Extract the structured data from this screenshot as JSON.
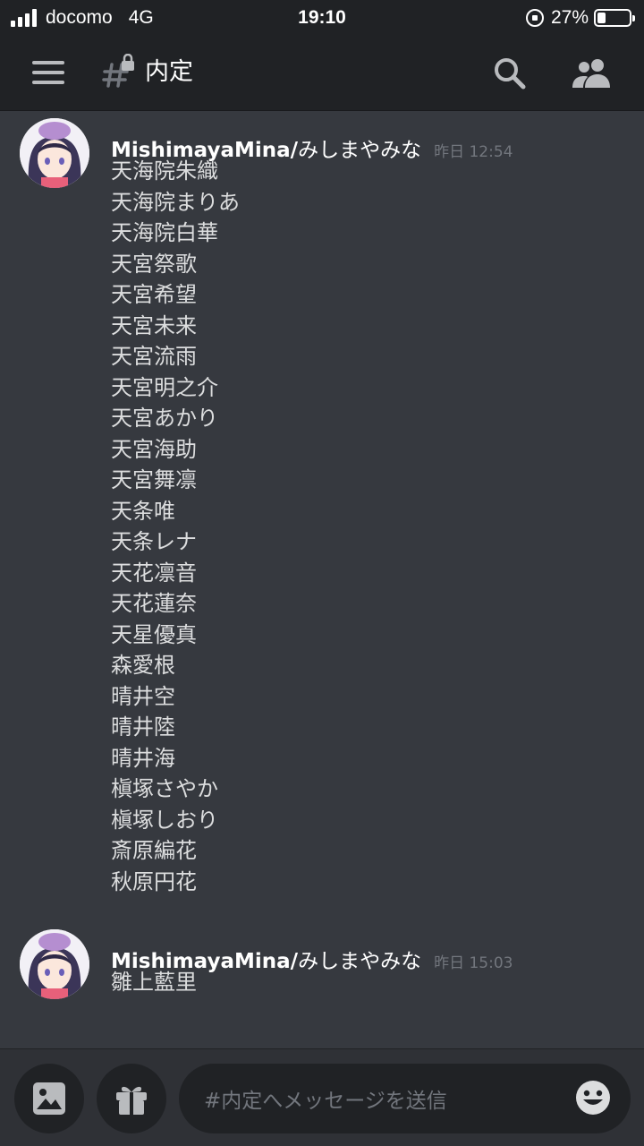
{
  "statusbar": {
    "carrier": "docomo",
    "network": "4G",
    "time": "19:10",
    "battery_percent": "27%",
    "battery_level": 0.27
  },
  "header": {
    "channel_name": "内定",
    "menu_icon": "hamburger-icon",
    "channel_icon": "locked-hash-icon",
    "search_icon": "search-icon",
    "members_icon": "members-icon"
  },
  "messages": [
    {
      "author": "MishimayaMina/",
      "author_jp": "みしまやみな",
      "timestamp": "昨日 12:54",
      "lines": [
        "天海院朱織",
        "天海院まりあ",
        "天海院白華",
        "天宮祭歌",
        "天宮希望",
        "天宮未来",
        "天宮流雨",
        "天宮明之介",
        "天宮あかり",
        "天宮海助",
        "天宮舞凛",
        "天条唯",
        "天条レナ",
        "天花凛音",
        "天花蓮奈",
        "天星優真",
        "森愛根",
        "晴井空",
        "晴井陸",
        "晴井海",
        "槇塚さやか",
        "槇塚しおり",
        "斎原編花",
        "秋原円花"
      ]
    },
    {
      "author": "MishimayaMina/",
      "author_jp": "みしまやみな",
      "timestamp": "昨日 15:03",
      "lines": [
        "雛上藍里"
      ]
    }
  ],
  "composer": {
    "placeholder": "#内定へメッセージを送信",
    "image_icon": "image-icon",
    "gift_icon": "gift-icon",
    "emoji_icon": "emoji-icon"
  },
  "colors": {
    "background": "#36393f",
    "header": "#202225",
    "text": "#dcddde",
    "muted": "#72767d"
  }
}
